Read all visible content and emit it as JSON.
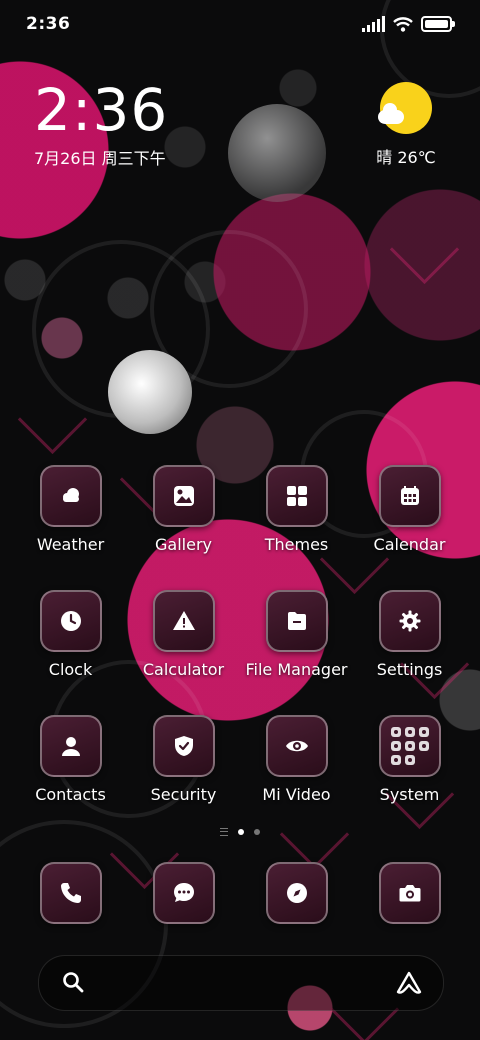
{
  "status_bar": {
    "time": "2:36"
  },
  "clock_widget": {
    "time": "2:36",
    "date": "7月26日 周三下午"
  },
  "weather_widget": {
    "text": "晴 26℃",
    "icon": "sunny-partly-cloudy-icon"
  },
  "apps": [
    {
      "label": "Weather",
      "icon": "weather-icon"
    },
    {
      "label": "Gallery",
      "icon": "gallery-icon"
    },
    {
      "label": "Themes",
      "icon": "themes-icon"
    },
    {
      "label": "Calendar",
      "icon": "calendar-icon"
    },
    {
      "label": "Clock",
      "icon": "clock-icon"
    },
    {
      "label": "Calculator",
      "icon": "calculator-icon"
    },
    {
      "label": "File Manager",
      "icon": "file-manager-icon"
    },
    {
      "label": "Settings",
      "icon": "settings-icon"
    },
    {
      "label": "Contacts",
      "icon": "contacts-icon"
    },
    {
      "label": "Security",
      "icon": "security-icon"
    },
    {
      "label": "Mi Video",
      "icon": "mi-video-icon"
    },
    {
      "label": "System",
      "icon": "system-folder-icon"
    }
  ],
  "page_indicator": {
    "pages": 2,
    "current": 1
  },
  "dock": [
    {
      "icon": "phone-icon"
    },
    {
      "icon": "messages-icon"
    },
    {
      "icon": "browser-icon"
    },
    {
      "icon": "camera-icon"
    }
  ],
  "search_bar": {
    "placeholder": ""
  },
  "colors": {
    "accent": "#e6207a",
    "tile_top": "#4a1e33",
    "tile_bottom": "#2a0d1a",
    "sun": "#f9d21b"
  }
}
